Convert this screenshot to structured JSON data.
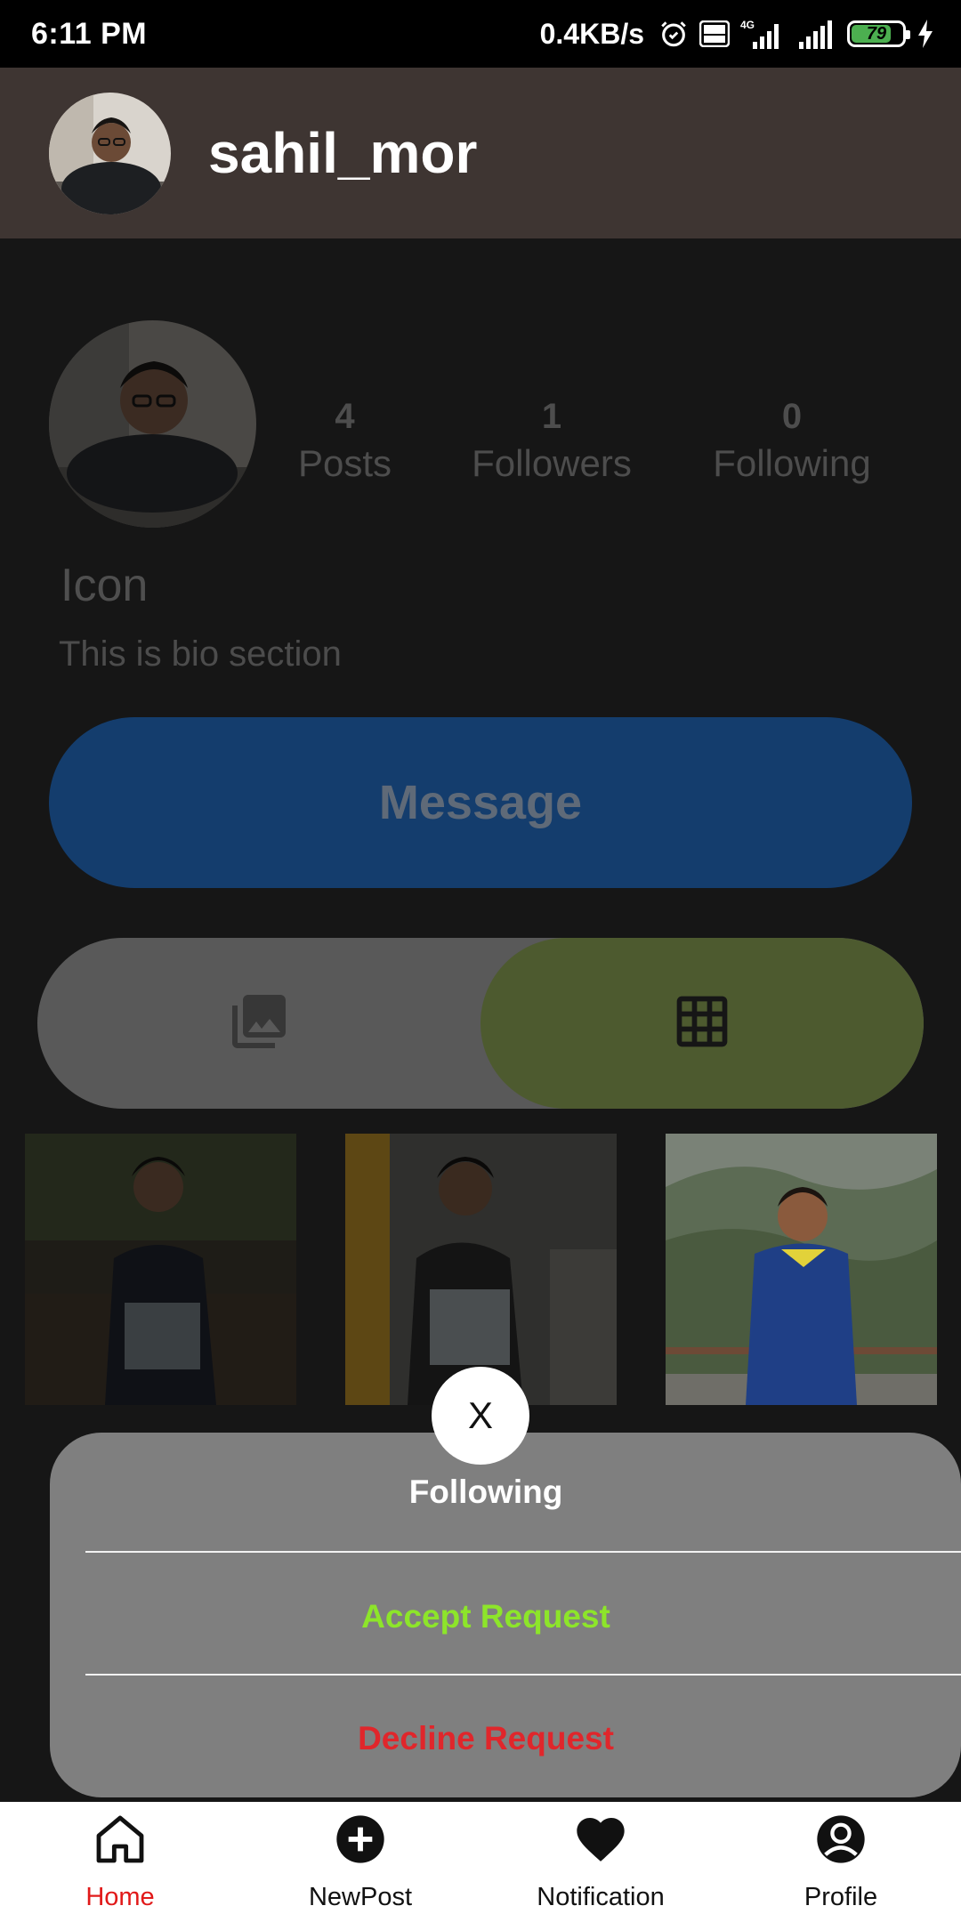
{
  "status_bar": {
    "time": "6:11 PM",
    "net_speed": "0.4KB/s",
    "battery_level": "79",
    "icons": [
      "alarm-icon",
      "volte-icon",
      "signal-4g-icon",
      "signal-icon",
      "battery-icon",
      "charging-icon"
    ]
  },
  "header": {
    "username": "sahil_mor"
  },
  "profile": {
    "stats": [
      {
        "value": "4",
        "label": "Posts"
      },
      {
        "value": "1",
        "label": "Followers"
      },
      {
        "value": "0",
        "label": "Following"
      }
    ],
    "display_name": "Icon",
    "bio": "This is bio section",
    "message_label": "Message"
  },
  "view_toggle": {
    "left_icon": "photo-library-icon",
    "right_icon": "grid-icon",
    "active": "grid"
  },
  "sheet": {
    "close_label": "X",
    "title": "Following",
    "accept_label": "Accept Request",
    "decline_label": "Decline Request",
    "accept_color": "#8de52a",
    "decline_color": "#e0262b"
  },
  "bottom_nav": {
    "items": [
      {
        "label": "Home",
        "icon": "home-icon",
        "active": true
      },
      {
        "label": "NewPost",
        "icon": "add-circle-icon",
        "active": false
      },
      {
        "label": "Notification",
        "icon": "heart-icon",
        "active": false
      },
      {
        "label": "Profile",
        "icon": "account-circle-icon",
        "active": false
      }
    ]
  },
  "colors": {
    "header_bg": "#3e3532",
    "active_nav": "#e11919",
    "message_button": "#143d6d"
  }
}
